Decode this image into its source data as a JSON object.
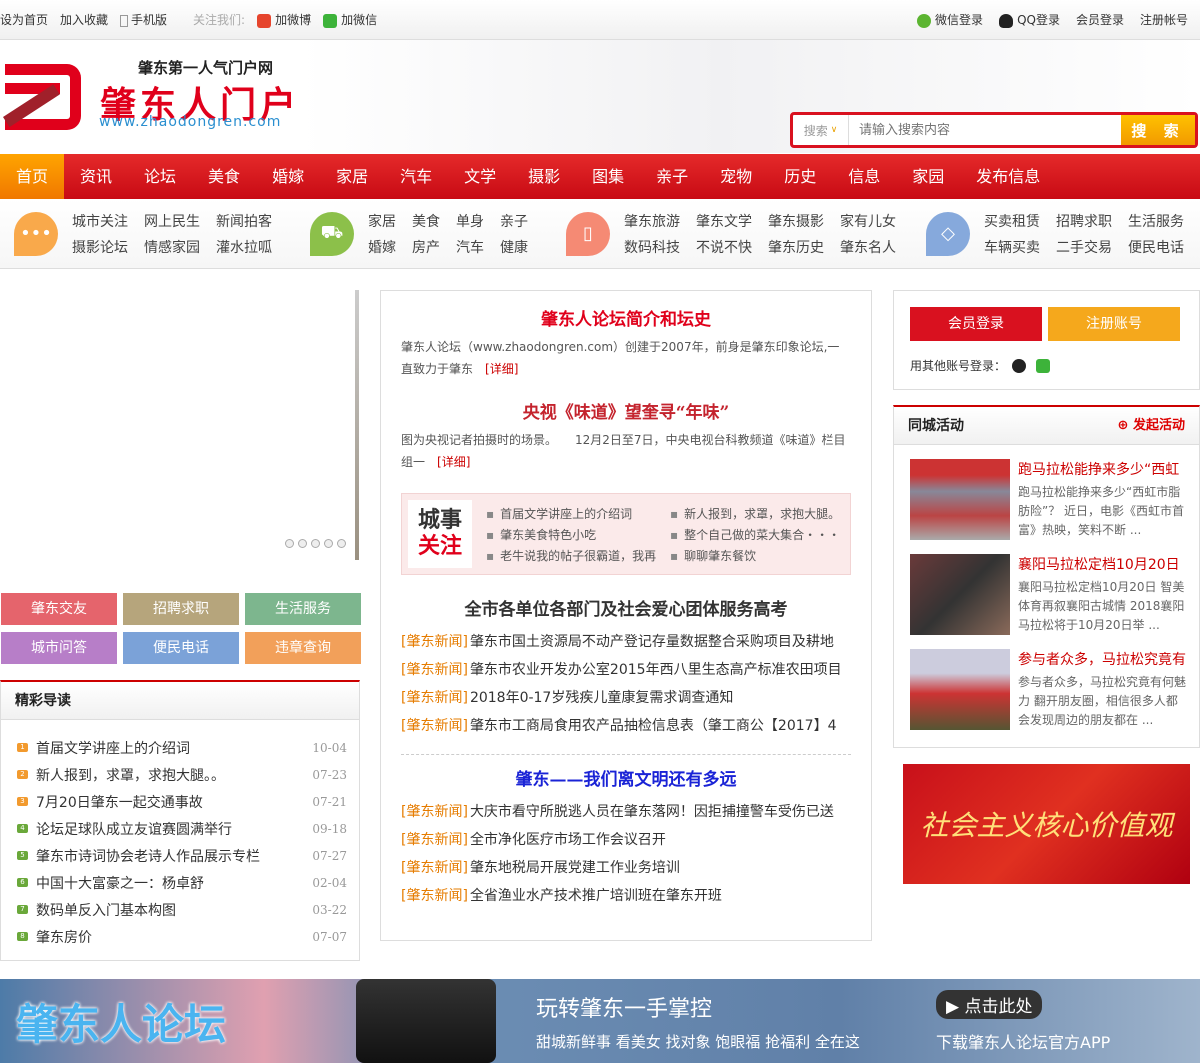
{
  "topbar": {
    "left": [
      "设为首页",
      "加入收藏",
      "手机版"
    ],
    "follow": "关注我们:",
    "weibo": "加微博",
    "weixin": "加微信",
    "right": {
      "wechat_login": "微信登录",
      "qq_login": "QQ登录",
      "member_login": "会员登录",
      "register": "注册帐号"
    }
  },
  "header": {
    "slogan": "肇东第一人气门户网",
    "brand": "肇东人门户",
    "url": "www.zhaodongren.com",
    "search": {
      "scope": "搜索",
      "placeholder": "请输入搜索内容",
      "button": "搜 索"
    }
  },
  "nav": [
    "首页",
    "资讯",
    "论坛",
    "美食",
    "婚嫁",
    "家居",
    "汽车",
    "文学",
    "摄影",
    "图集",
    "亲子",
    "宠物",
    "历史",
    "信息",
    "家园",
    "发布信息"
  ],
  "subnav": [
    {
      "icon": "chat-bubble-icon",
      "color": "#f9a94b",
      "items": [
        "城市关注",
        "网上民生",
        "新闻拍客",
        "摄影论坛",
        "情感家园",
        "灌水拉呱"
      ]
    },
    {
      "icon": "cart-icon",
      "color": "#8cc04a",
      "items": [
        "家居",
        "美食",
        "单身",
        "亲子",
        "婚嫁",
        "房产",
        "汽车",
        "健康"
      ]
    },
    {
      "icon": "drink-icon",
      "color": "#f58a74",
      "items": [
        "肇东旅游",
        "肇东文学",
        "肇东摄影",
        "家有儿女",
        "数码科技",
        "不说不快",
        "肇东历史",
        "肇东名人"
      ]
    },
    {
      "icon": "tag-icon",
      "color": "#86a9dc",
      "items": [
        "买卖租赁",
        "招聘求职",
        "生活服务",
        "车辆买卖",
        "二手交易",
        "便民电话"
      ]
    }
  ],
  "quick_buttons": [
    {
      "label": "肇东交友",
      "color": "#e5646c"
    },
    {
      "label": "招聘求职",
      "color": "#b6a57c"
    },
    {
      "label": "生活服务",
      "color": "#7db68e"
    },
    {
      "label": "城市问答",
      "color": "#b77ec8"
    },
    {
      "label": "便民电话",
      "color": "#7ba2d8"
    },
    {
      "label": "违章查询",
      "color": "#f2a05a"
    }
  ],
  "guide": {
    "title": "精彩导读",
    "items": [
      {
        "n": "1",
        "title": "首届文学讲座上的介绍词",
        "date": "10-04"
      },
      {
        "n": "2",
        "title": "新人报到，求罩，求抱大腿。。",
        "date": "07-23"
      },
      {
        "n": "3",
        "title": "7月20日肇东一起交通事故",
        "date": "07-21"
      },
      {
        "n": "4",
        "title": "论坛足球队成立友谊赛圆满举行",
        "date": "09-18"
      },
      {
        "n": "5",
        "title": "肇东市诗词协会老诗人作品展示专栏",
        "date": "07-27"
      },
      {
        "n": "6",
        "title": "中国十大富豪之一：杨卓舒",
        "date": "02-04"
      },
      {
        "n": "7",
        "title": "数码单反入门基本构图",
        "date": "03-22"
      },
      {
        "n": "8",
        "title": "肇东房价",
        "date": "07-07"
      }
    ]
  },
  "middle": {
    "a1": {
      "title": "肇东人论坛简介和坛史",
      "body": "肇东人论坛（www.zhaodongren.com）创建于2007年，前身是肇东印象论坛,一直致力于肇东",
      "more": "[详细]"
    },
    "a2": {
      "title": "央视《味道》望奎寻“年味”",
      "body": "图为央视记者拍摄时的场景。　　12月2日至7日，中央电视台科教频道《味道》栏目组一",
      "more": "[详细]"
    },
    "focus": {
      "l1": "城事",
      "l2": "关注",
      "items": [
        "首届文学讲座上的介绍词",
        "新人报到，求罩，求抱大腿。",
        "肇东美食特色小吃",
        "整个自己做的菜大集合・・・",
        "老牛说我的帖子很霸道，我再",
        "聊聊肇东餐饮"
      ]
    },
    "h3": "全市各单位各部门及社会爱心团体服务高考",
    "tag": "[肇东新闻]",
    "news1": [
      "肇东市国土资源局不动产登记存量数据整合采购项目及耕地",
      "肇东市农业开发办公室2015年西八里生态高产标准农田项目",
      "2018年0-17岁残疾儿童康复需求调查通知",
      "肇东市工商局食用农产品抽检信息表（肇工商公【2017】4"
    ],
    "h4": "肇东——我们离文明还有多远",
    "news2": [
      "大庆市看守所脱逃人员在肇东落网！因拒捕撞警车受伤已送",
      "全市净化医疗市场工作会议召开",
      "肇东地税局开展党建工作业务培训",
      "全省渔业水产技术推广培训班在肇东开班"
    ]
  },
  "login": {
    "member": "会员登录",
    "register": "注册账号",
    "other": "用其他账号登录："
  },
  "activity": {
    "title": "同城活动",
    "launch": "发起活动",
    "items": [
      {
        "title": "跑马拉松能挣来多少“西虹",
        "desc": "跑马拉松能挣来多少“西虹市脂肪险”？ 近日，电影《西虹市首富》热映，笑料不断 ..."
      },
      {
        "title": "襄阳马拉松定档10月20日",
        "desc": "襄阳马拉松定档10月20日 智美体育再叙襄阳古城情 2018襄阳马拉松将于10月20日举 ..."
      },
      {
        "title": "参与者众多，马拉松究竟有",
        "desc": "参与者众多，马拉松究竟有何魅力 翻开朋友圈，相信很多人都会发现周边的朋友都在 ..."
      }
    ]
  },
  "ad": "社会主义核心价值观",
  "banner": {
    "title": "肇东人论坛",
    "slogan": "玩转肇东一手掌控",
    "sub": "甜城新鲜事 看美女 找对象 饱眼福 抢福利 全在这",
    "click": "点击此处",
    "download": "下载肇东人论坛官方APP"
  }
}
